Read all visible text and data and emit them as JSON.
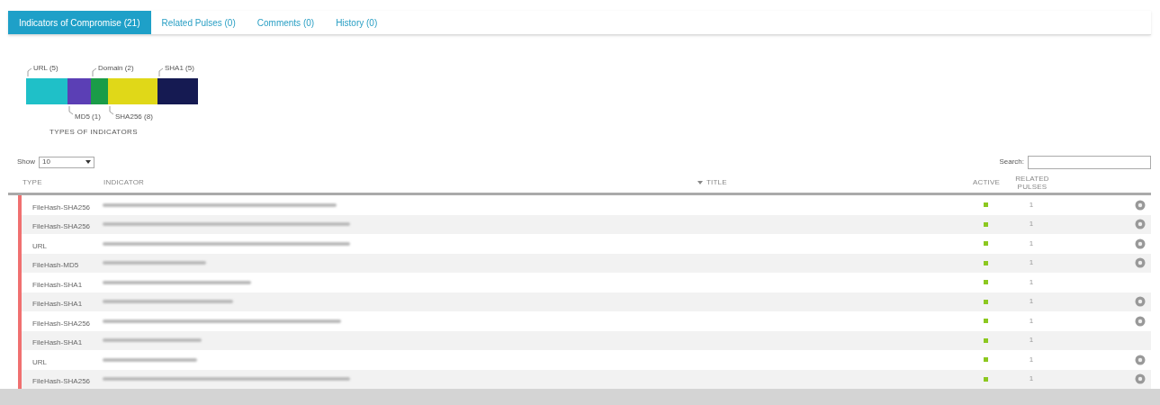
{
  "tabs": [
    {
      "label": "Indicators of Compromise (21)",
      "selected": true
    },
    {
      "label": "Related Pulses (0)",
      "selected": false
    },
    {
      "label": "Comments (0)",
      "selected": false
    },
    {
      "label": "History (0)",
      "selected": false
    }
  ],
  "chart": {
    "caption": "TYPES OF INDICATORS",
    "segments": [
      {
        "label": "URL (5)",
        "color": "#1fc0c8"
      },
      {
        "label": "MD5 (1)",
        "color": "#5b3fb5"
      },
      {
        "label": "Domain (2)",
        "color": "#1a9c48"
      },
      {
        "label": "SHA256 (8)",
        "color": "#e0d818"
      },
      {
        "label": "SHA1 (5)",
        "color": "#151a52"
      }
    ]
  },
  "length": {
    "label": "Show",
    "value": "10"
  },
  "search": {
    "label": "Search:"
  },
  "table": {
    "columns": [
      "TYPE",
      "INDICATOR",
      "TITLE",
      "ACTIVE",
      "RELATED PULSES"
    ],
    "rows": [
      {
        "type": "FileHash-SHA256",
        "active": true,
        "related": "1",
        "gear": true
      },
      {
        "type": "FileHash-SHA256",
        "active": true,
        "related": "1",
        "gear": true
      },
      {
        "type": "URL",
        "active": true,
        "related": "1",
        "gear": true
      },
      {
        "type": "FileHash-MD5",
        "active": true,
        "related": "1",
        "gear": true
      },
      {
        "type": "FileHash-SHA1",
        "active": true,
        "related": "1",
        "gear": false
      },
      {
        "type": "FileHash-SHA1",
        "active": true,
        "related": "1",
        "gear": true
      },
      {
        "type": "FileHash-SHA256",
        "active": true,
        "related": "1",
        "gear": true
      },
      {
        "type": "FileHash-SHA1",
        "active": true,
        "related": "1",
        "gear": false
      },
      {
        "type": "URL",
        "active": true,
        "related": "1",
        "gear": true
      },
      {
        "type": "FileHash-SHA256",
        "active": true,
        "related": "1",
        "gear": true
      }
    ]
  }
}
